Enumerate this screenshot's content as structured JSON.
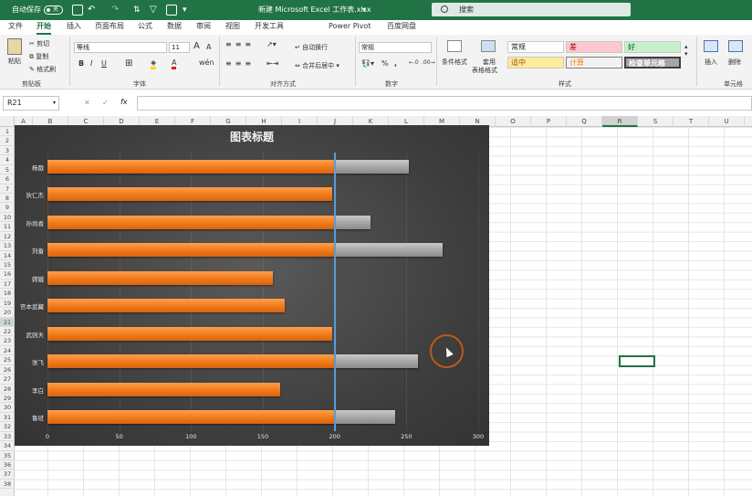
{
  "titlebar": {
    "autosave": "自动保存",
    "toggle": "关",
    "doc_title": "新建 Microsoft Excel 工作表.xlsx",
    "search_placeholder": "搜索"
  },
  "tabs": [
    "文件",
    "开始",
    "插入",
    "页面布局",
    "公式",
    "数据",
    "审阅",
    "视图",
    "开发工具",
    "Power Pivot",
    "百度网盘"
  ],
  "active_tab": "开始",
  "ribbon": {
    "clipboard": {
      "paste": "粘贴",
      "cut": "剪切",
      "copy": "复制",
      "format_painter": "格式刷",
      "group": "剪贴板"
    },
    "font": {
      "name": "等线",
      "size": "11",
      "bold": "B",
      "italic": "I",
      "underline": "U",
      "grow": "A",
      "shrink": "A",
      "color": "A",
      "group": "字体"
    },
    "align": {
      "wrap": "自动换行",
      "merge": "合并后居中",
      "group": "对齐方式"
    },
    "number": {
      "format": "常规",
      "percent": "%",
      "group": "数字"
    },
    "styles": {
      "cond": "条件格式",
      "table": "套用",
      "table2": "表格格式",
      "normal": "常规",
      "bad": "差",
      "good": "好",
      "neutral": "适中",
      "calc": "计算",
      "check": "检查单元格",
      "group": "样式"
    },
    "cells": {
      "insert": "插入",
      "delete": "删除",
      "group": "单元格"
    }
  },
  "formula_bar": {
    "name_box": "R21",
    "cancel": "✕",
    "enter": "✓",
    "fx": "fx",
    "value": ""
  },
  "columns": [
    "A",
    "B",
    "C",
    "D",
    "E",
    "F",
    "G",
    "H",
    "I",
    "J",
    "K",
    "L",
    "M",
    "N",
    "O",
    "P",
    "Q",
    "R",
    "S",
    "T",
    "U"
  ],
  "selected_column": "R",
  "selected_row": "21",
  "rows": [
    "1",
    "2",
    "3",
    "4",
    "5",
    "6",
    "7",
    "8",
    "9",
    "10",
    "11",
    "12",
    "13",
    "14",
    "15",
    "16",
    "17",
    "18",
    "19",
    "20",
    "21",
    "22",
    "23",
    "24",
    "25",
    "26",
    "27",
    "28",
    "29",
    "30",
    "31",
    "32",
    "33",
    "34",
    "35",
    "36",
    "37",
    "38"
  ],
  "colors": {
    "excel_green": "#217346",
    "bar_orange": "#f07a1a",
    "bar_gray": "#a5a5a5",
    "ref_line": "#5b9bd5"
  },
  "chart_data": {
    "type": "bar",
    "orientation": "horizontal",
    "title": "图表标题",
    "categories": [
      "杨戬",
      "狄仁杰",
      "孙尚香",
      "刘备",
      "嫦娥",
      "宫本武藏",
      "武则天",
      "张飞",
      "李白",
      "鲁班"
    ],
    "values": [
      252,
      198,
      225,
      275,
      157,
      165,
      198,
      258,
      162,
      242
    ],
    "threshold": 200,
    "xlim": [
      0,
      300
    ],
    "xticks": [
      "0",
      "50",
      "100",
      "150",
      "200",
      "250",
      "300"
    ],
    "grid": false,
    "legend": "none"
  }
}
